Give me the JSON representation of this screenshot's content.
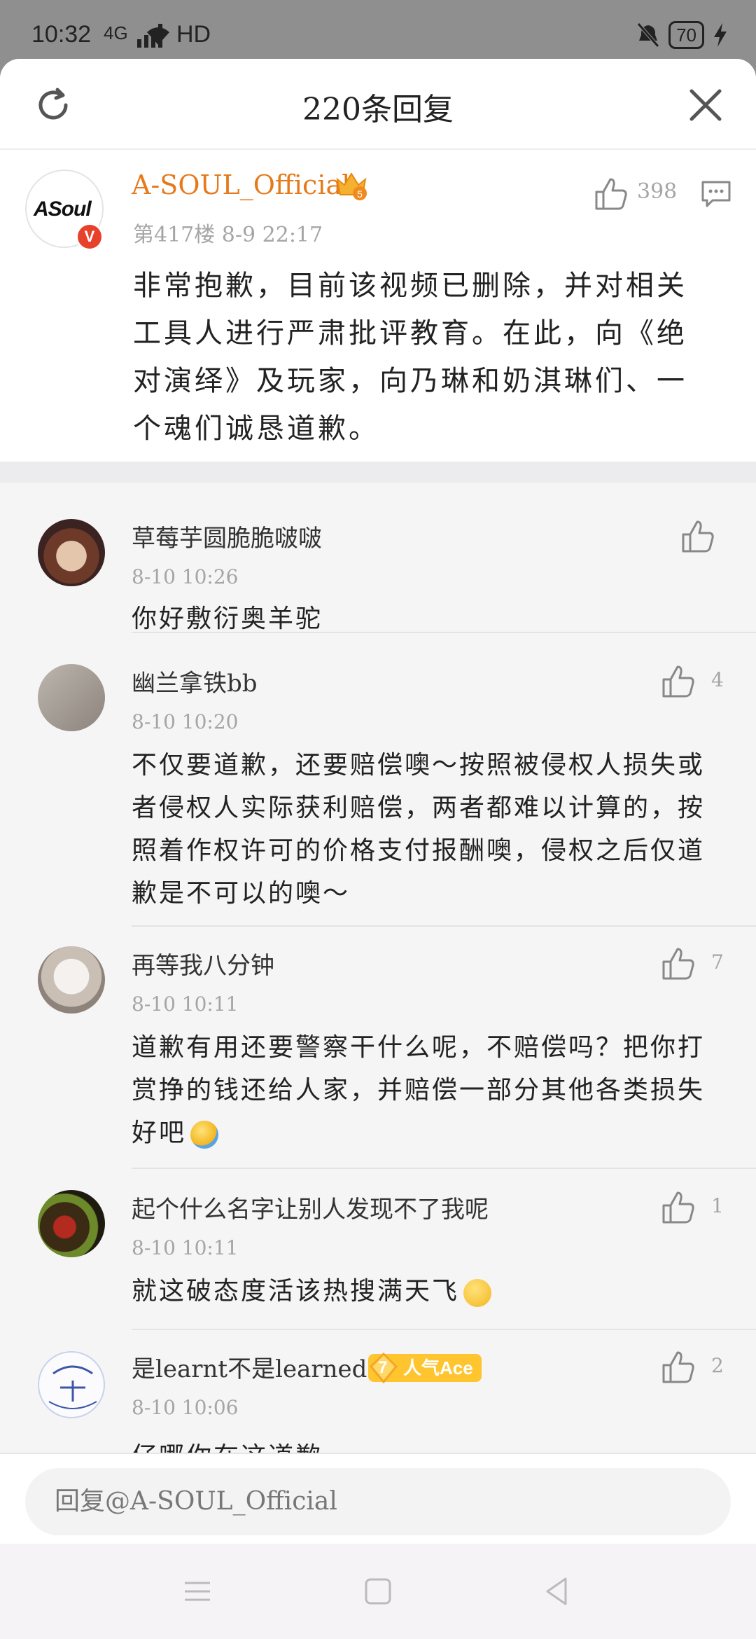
{
  "status": {
    "time": "10:32",
    "network": "4G",
    "hd": "HD",
    "battery": "70"
  },
  "header": {
    "title": "220条回复"
  },
  "main_comment": {
    "author": "A-SOUL_Official",
    "logo_text": "ASoul",
    "verified_mark": "V",
    "meta": "第417楼  8-9 22:17",
    "likes": "398",
    "text": "非常抱歉，目前该视频已删除，并对相关工具人进行严肃批评教育。在此，向《绝对演绎》及玩家，向乃琳和奶淇琳们、一个魂们诚恳道歉。"
  },
  "replies": [
    {
      "name": "草莓芋圆脆脆啵啵",
      "time": "8-10 10:26",
      "likes": "",
      "text": "你好敷衍奥羊驼"
    },
    {
      "name": "幽兰拿铁bb",
      "time": "8-10 10:20",
      "likes": "4",
      "text": "不仅要道歉，还要赔偿噢～按照被侵权人损失或者侵权人实际获利赔偿，两者都难以计算的，按照着作权许可的价格支付报酬噢，侵权之后仅道歉是不可以的噢～"
    },
    {
      "name": "再等我八分钟",
      "time": "8-10 10:11",
      "likes": "7",
      "text": "道歉有用还要警察干什么呢，不赔偿吗？把你打赏挣的钱还给人家，并赔偿一部分其他各类损失好吧"
    },
    {
      "name": "起个什么名字让别人发现不了我呢",
      "time": "8-10 10:11",
      "likes": "1",
      "text": "就这破态度活该热搜满天飞"
    },
    {
      "name": "是learnt不是learned",
      "time": "8-10 10:06",
      "likes": "2",
      "badge_level": "7",
      "badge_text": "人气Ace",
      "text": "仔哪你在这道歉"
    }
  ],
  "reply_bar": {
    "placeholder": "回复@A-SOUL_Official"
  },
  "colors": {
    "author_orange": "#e67a1b",
    "badge_yellow": "#ffc52f",
    "verified_red": "#e8412b"
  }
}
